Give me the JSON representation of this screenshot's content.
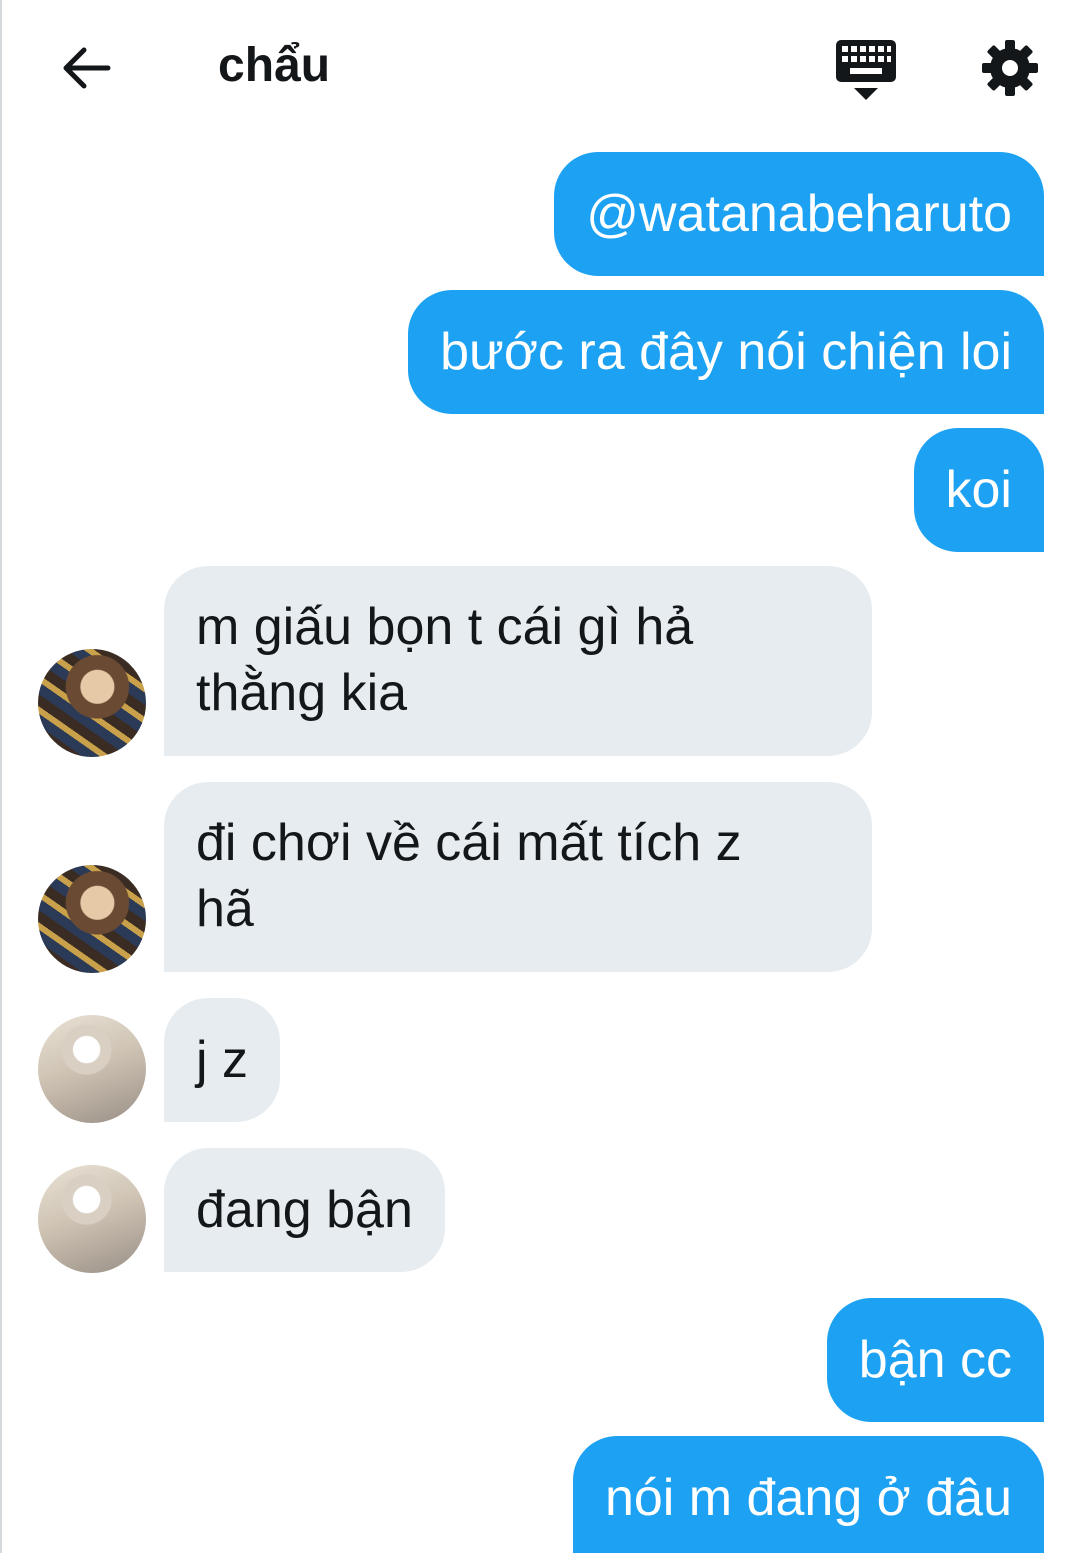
{
  "header": {
    "title": "chẩu",
    "back_icon": "arrow-left-icon",
    "keyboard_icon": "keyboard-icon",
    "settings_icon": "gear-icon"
  },
  "colors": {
    "outgoing_bubble": "#1da1f2",
    "incoming_bubble": "#e6ecf0",
    "text_dark": "#14171a"
  },
  "messages": [
    {
      "side": "out",
      "text": "@watanabeharuto"
    },
    {
      "side": "out",
      "text": "bước ra đây nói chiện loi"
    },
    {
      "side": "out",
      "text": "koi"
    },
    {
      "side": "in",
      "sender_avatar": "avatar-a",
      "lines": [
        "m giấu bọn t cái gì hả",
        "thằng kia"
      ]
    },
    {
      "side": "in",
      "sender_avatar": "avatar-a",
      "lines": [
        "đi chơi về cái mất tích z",
        "hã"
      ]
    },
    {
      "side": "in",
      "sender_avatar": "avatar-b",
      "text": "j z"
    },
    {
      "side": "in",
      "sender_avatar": "avatar-b",
      "text": "đang bận"
    },
    {
      "side": "out",
      "text": "bận cc"
    },
    {
      "side": "out",
      "text": "nói m đang ở đâu"
    }
  ]
}
